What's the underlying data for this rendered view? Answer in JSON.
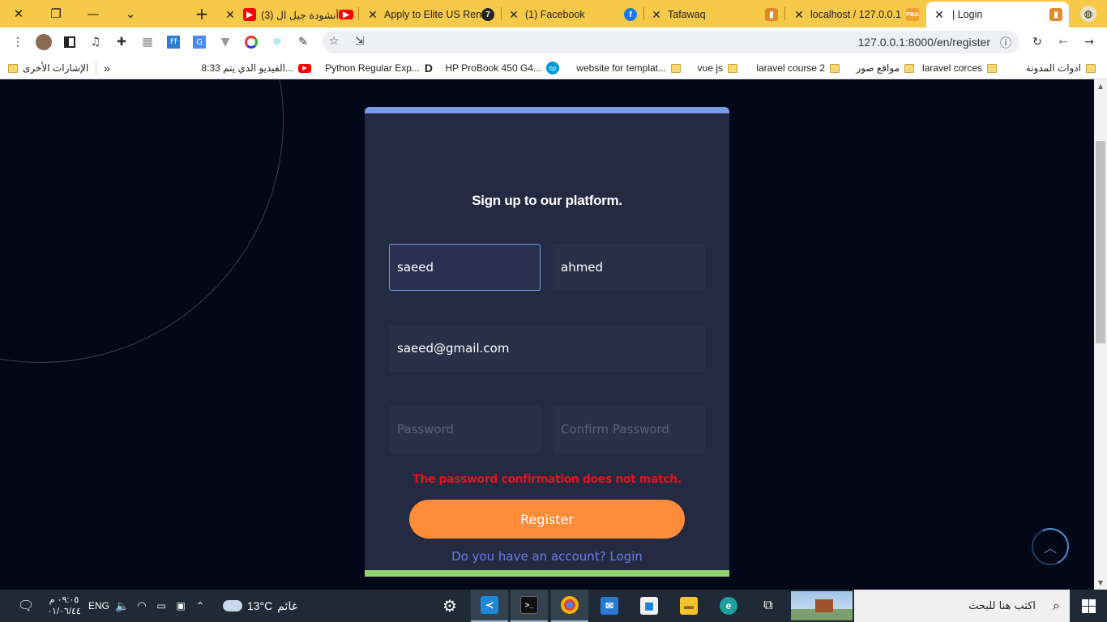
{
  "browser": {
    "tabs": [
      {
        "title": "أنشودة جيل ال (3)",
        "icon": "youtube-icon",
        "color": "#ff0000"
      },
      {
        "title": "Apply to Elite US Ren",
        "icon": "seven-icon",
        "color": "#222222"
      },
      {
        "title": "(1) Facebook",
        "icon": "facebook-icon",
        "color": "#1877f2"
      },
      {
        "title": "Tafawaq",
        "icon": "book-icon",
        "color": "#e08a2c"
      },
      {
        "title": "localhost / 127.0.0.1",
        "icon": "phpmyadmin-icon",
        "color": "#f0a030"
      },
      {
        "title": "| Login",
        "icon": "book-icon",
        "color": "#e08a2c"
      }
    ],
    "new_tab_label": "+",
    "url": "127.0.0.1:8000/en/register",
    "bookmarks": [
      {
        "label": "ادوات المدونة",
        "type": "folder"
      },
      {
        "label": "laravel corces",
        "type": "folder"
      },
      {
        "label": "مواقع صور",
        "type": "folder"
      },
      {
        "label": "laravel course 2",
        "type": "folder"
      },
      {
        "label": "vue js",
        "type": "folder"
      },
      {
        "label": "website for templat...",
        "type": "folder"
      },
      {
        "label": "HP ProBook 450 G4...",
        "type": "hp"
      },
      {
        "label": "Python Regular Exp...",
        "type": "d"
      },
      {
        "label": "8:33 الفيديو الذي يتم...",
        "type": "youtube"
      }
    ],
    "bookmarks_more": "»",
    "other_bookmarks": "الإشارات الأخرى"
  },
  "form": {
    "heading": "Sign up to our platform.",
    "first_name": "saeed",
    "last_name": "ahmed",
    "email": "saeed@gmail.com",
    "password_placeholder": "Password",
    "confirm_placeholder": "Confirm Password",
    "error": "The password confirmation does not match.",
    "register_label": "Register",
    "login_link": "Do you have an account? Login"
  },
  "colors": {
    "card_bg": "#232a42",
    "top_bar": "#7b9be8",
    "bottom_bar": "#8fd36e",
    "button": "#ff8c38",
    "error": "#e81020",
    "link": "#6a7ee8"
  },
  "taskbar": {
    "search_placeholder": "اكتب هنا للبحث",
    "time": "٠٩:٠٥ م",
    "date": "٠١/٠٦/٤٤",
    "language": "ENG",
    "temperature": "13°C",
    "weather": "غائم",
    "weather_icon": "cloud-icon"
  }
}
